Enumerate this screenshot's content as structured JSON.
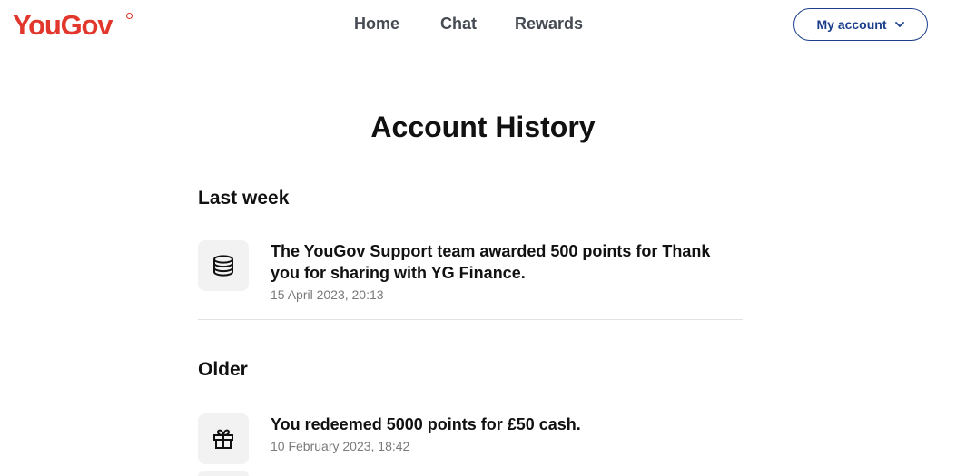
{
  "header": {
    "logo_text": "YouGov",
    "nav": {
      "home": "Home",
      "chat": "Chat",
      "rewards": "Rewards"
    },
    "account_button_label": "My account",
    "colors": {
      "brand_red": "#e2372c",
      "account_blue": "#1c3f8c",
      "nav_gray": "#454a53"
    }
  },
  "main": {
    "title": "Account History",
    "sections": [
      {
        "heading": "Last week",
        "entries": [
          {
            "icon": "coins-icon",
            "title": "The YouGov Support team awarded 500 points for Thank you for sharing with YG Finance.",
            "date": "15 April 2023, 20:13"
          }
        ]
      },
      {
        "heading": "Older",
        "entries": [
          {
            "icon": "gift-icon",
            "title": "You redeemed 5000 points for £50 cash.",
            "date": "10 February 2023, 18:42"
          }
        ]
      }
    ]
  }
}
